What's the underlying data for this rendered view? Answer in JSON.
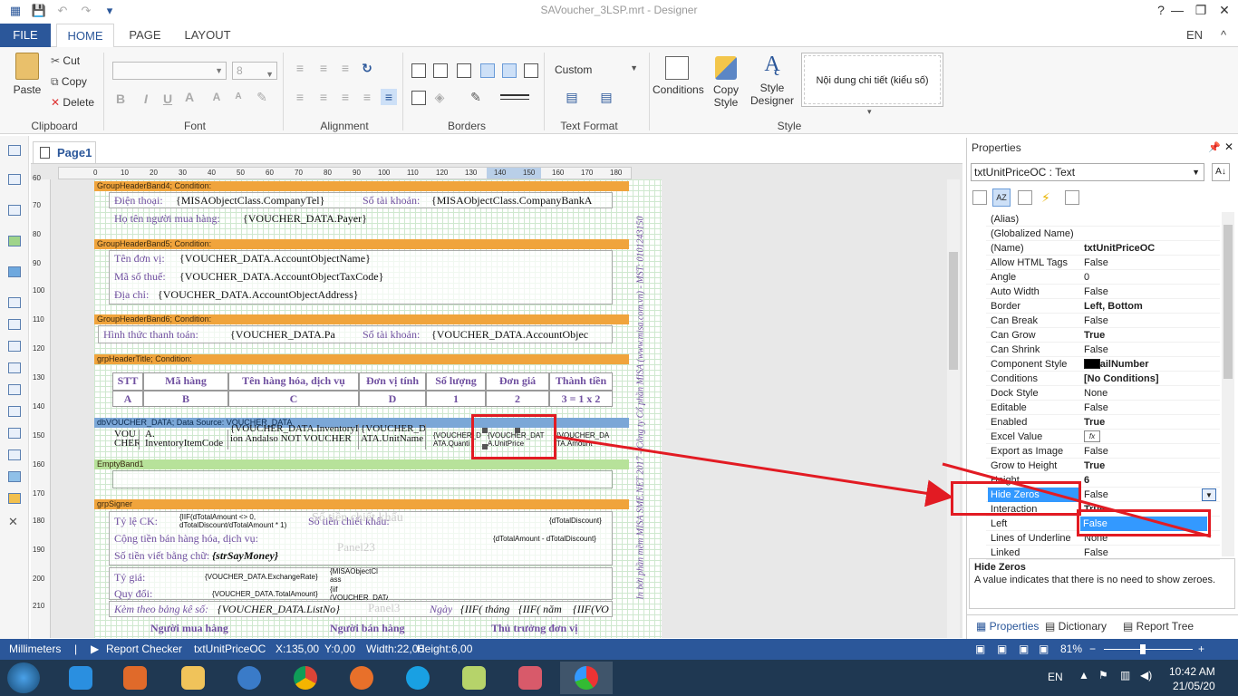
{
  "window": {
    "title": "SAVoucher_3LSP.mrt - Designer",
    "help": "?"
  },
  "ribbon_tabs": {
    "file": "FILE",
    "home": "HOME",
    "page": "PAGE",
    "layout": "LAYOUT",
    "lang": "EN"
  },
  "clipboard": {
    "paste": "Paste",
    "cut": "Cut",
    "copy": "Copy",
    "delete": "Delete",
    "label": "Clipboard"
  },
  "font": {
    "size": "8",
    "bold": "B",
    "italic": "I",
    "underline": "U",
    "label": "Font"
  },
  "alignment": {
    "label": "Alignment"
  },
  "borders": {
    "label": "Borders"
  },
  "text_format": {
    "value": "Custom",
    "label": "Text Format"
  },
  "style": {
    "conditions": "Conditions",
    "copy_style": "Copy Style",
    "style_designer": "Style Designer",
    "style_box": "Nội dung chi tiết (kiểu số)",
    "label": "Style"
  },
  "page_tab": "Page1",
  "ruler_h": [
    "0",
    "10",
    "20",
    "30",
    "40",
    "50",
    "60",
    "70",
    "80",
    "90",
    "100",
    "110",
    "120",
    "130",
    "140",
    "150",
    "160",
    "170",
    "180"
  ],
  "ruler_v": [
    "60",
    "70",
    "80",
    "90",
    "100",
    "110",
    "120",
    "130",
    "140",
    "150",
    "160",
    "170",
    "180",
    "190",
    "200",
    "210"
  ],
  "bands": {
    "g4": "GroupHeaderBand4; Condition:",
    "g5": "GroupHeaderBand5; Condition:",
    "g6": "GroupHeaderBand6; Condition:",
    "title": "grpHeaderTitle; Condition:",
    "data": "dbVOUCHER_DATA; Data Source: VOUCHER_DATA",
    "empty": "EmptyBand1",
    "signer": "grpSigner"
  },
  "fields": {
    "phone_lbl": "Điện thoại:",
    "phone_val": "{MISAObjectClass.CompanyTel}",
    "bank_lbl": "Số tài khoản:",
    "bank_val": "{MISAObjectClass.CompanyBankA",
    "buyer_lbl": "Họ tên người mua hàng:",
    "buyer_val": "{VOUCHER_DATA.Payer}",
    "unit_lbl": "Tên đơn vị:",
    "unit_val": "{VOUCHER_DATA.AccountObjectName}",
    "tax_lbl": "Mã số thuế:",
    "tax_val": "{VOUCHER_DATA.AccountObjectTaxCode}",
    "addr_lbl": "Địa chỉ:",
    "addr_val": "{VOUCHER_DATA.AccountObjectAddress}",
    "pay_lbl": "Hình thức thanh toán:",
    "pay_val": "{VOUCHER_DATA.Pa",
    "acct_lbl": "Số tài khoản:",
    "acct_val": "{VOUCHER_DATA.AccountObjec"
  },
  "table_header": {
    "cols": [
      "STT",
      "Mã hàng",
      "Tên hàng hóa, dịch vụ",
      "Đơn vị tính",
      "Số lượng",
      "Đơn giá",
      "Thành tiền"
    ],
    "codes": [
      "A",
      "B",
      "C",
      "D",
      "1",
      "2",
      "3 = 1 x 2"
    ]
  },
  "data_row": [
    "VOU CHER",
    "A. InventoryItemCode",
    "{VOUCHER_DATA.InventoryItemName} ion Andalso NOT VOUCHER",
    "{VOUCHER_D ATA.UnitName",
    "{VOUCHER_D ATA.Quanti",
    "{VOUCHER_DAT A.UnitPrice",
    "{VOUCHER_DA TA.Amount"
  ],
  "signer": {
    "rate_lbl": "Tỷ lệ CK:",
    "rate_val": "{IIF(dTotalAmount <> 0, dTotalDiscount/dTotalAmount * 1)",
    "disc_lbl": "Số tiền chiết khấu:",
    "disc_val": "{dTotalDiscount}",
    "disc_bg": "Số tiền chiết khấu",
    "sum_lbl": "Cộng tiền bán hàng hóa, dịch vụ:",
    "sum_val": "{dTotalAmount - dTotalDiscount}",
    "panel23": "Panel23",
    "words_lbl": "Số tiền viết bằng chữ:",
    "words_val": "{strSayMoney}",
    "ex_lbl": "Tỷ giá:",
    "ex_val": "{VOUCHER_DATA.ExchangeRate}",
    "ex_cl": "{MISAObjectCl ass",
    "conv_lbl": "Quy đổi:",
    "conv_val": "{VOUCHER_DATA.TotalAmount}",
    "conv_iif": "{iif (VOUCHER_DATA",
    "att_lbl": "Kèm theo bảng kê số:",
    "att_val": "{VOUCHER_DATA.ListNo}",
    "panel3": "Panel3",
    "date_lbl": "Ngày",
    "iif1": "{IIF( tháng",
    "iif2": "{IIF( năm",
    "iif3": "{IIF(VO",
    "buyer_sig": "Người mua hàng",
    "seller_sig": "Người bán hàng",
    "head_sig": "Thủ trưởng đơn vị"
  },
  "vertical_text": "In bởi phần mềm MISA SME.NET 2017 - Công ty Cổ phần MISA (www.misa.com.vn) - MST: 0101243150",
  "properties": {
    "title": "Properties",
    "object": "txtUnitPriceOC : Text",
    "rows": [
      {
        "n": "(Alias)",
        "v": ""
      },
      {
        "n": "(Globalized Name)",
        "v": ""
      },
      {
        "n": "(Name)",
        "v": "txtUnitPriceOC"
      },
      {
        "n": "Allow HTML Tags",
        "v": "False"
      },
      {
        "n": "Angle",
        "v": "0"
      },
      {
        "n": "Auto Width",
        "v": "False"
      },
      {
        "n": "Border",
        "v": "Left, Bottom"
      },
      {
        "n": "Can Break",
        "v": "False"
      },
      {
        "n": "Can Grow",
        "v": "True"
      },
      {
        "n": "Can Shrink",
        "v": "False"
      },
      {
        "n": "Component Style",
        "v": "DetailNumber"
      },
      {
        "n": "Conditions",
        "v": "[No Conditions]"
      },
      {
        "n": "Dock Style",
        "v": "None"
      },
      {
        "n": "Editable",
        "v": "False"
      },
      {
        "n": "Enabled",
        "v": "True"
      },
      {
        "n": "Excel Value",
        "v": ""
      },
      {
        "n": "Export as Image",
        "v": "False"
      },
      {
        "n": "Grow to Height",
        "v": "True"
      },
      {
        "n": "Height",
        "v": "6"
      },
      {
        "n": "Hide Zeros",
        "v": "False"
      },
      {
        "n": "Interaction",
        "v": "True"
      },
      {
        "n": "Left",
        "v": ""
      },
      {
        "n": "Lines of Underline",
        "v": "None"
      },
      {
        "n": "Linked",
        "v": "False"
      }
    ],
    "dropdown_option": "False",
    "desc_title": "Hide Zeros",
    "desc_text": "A value indicates that there is no need to show zeroes.",
    "tabs": [
      "Properties",
      "Dictionary",
      "Report Tree"
    ]
  },
  "status": {
    "units": "Millimeters",
    "checker": "Report Checker",
    "component": "txtUnitPriceOC",
    "x": "X:135,00",
    "y": "Y:0,00",
    "width": "Width:22,00",
    "height": "Height:6,00",
    "zoom": "81%"
  },
  "taskbar": {
    "lang": "EN",
    "time": "10:42 AM",
    "date": "21/05/20"
  },
  "colors": {
    "accent": "#2b579a",
    "annotation": "#e21b23",
    "band_orange": "#f0a43c"
  }
}
